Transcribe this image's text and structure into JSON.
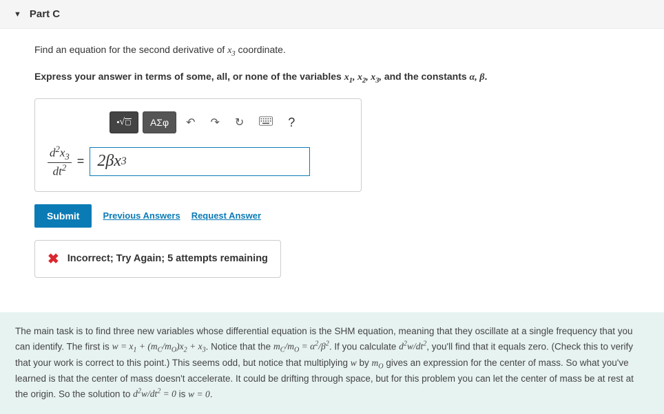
{
  "header": {
    "title": "Part C"
  },
  "question": {
    "line1_prefix": "Find an equation for the second derivative of ",
    "line1_var": "x₃",
    "line1_suffix": " coordinate.",
    "line2_prefix": "Express your answer in terms of some, all, or none of the variables ",
    "line2_vars": "x₁, x₂, x₃,",
    "line2_mid": " and the constants ",
    "line2_consts": "α, β",
    "line2_end": "."
  },
  "toolbar": {
    "math_btn": "√▭",
    "greek_btn": "ΑΣφ",
    "undo": "↶",
    "redo": "↷",
    "reset": "↻",
    "help": "?"
  },
  "equation": {
    "lhs_num": "d²x₃",
    "lhs_den": "dt²",
    "equals": "=",
    "answer": "2βx₃"
  },
  "actions": {
    "submit": "Submit",
    "previous": "Previous Answers",
    "request": "Request Answer"
  },
  "feedback": {
    "message": "Incorrect; Try Again; 5 attempts remaining"
  },
  "hint": {
    "text_html": "The main task is to find three new variables whose differential equation is the SHM equation, meaning that they oscillate at a single frequency that you can identify. The first is <span class='math'>w = x<sub>1</sub> + (m<sub>C</sub>/m<sub>O</sub>)x<sub>2</sub> + x<sub>3</sub></span>. Notice that the <span class='math'>m<sub>C</sub>/m<sub>O</sub> = α<sup>2</sup>/β<sup>2</sup></span>. If you calculate <span class='math'>d<sup>2</sup>w/dt<sup>2</sup></span>, you'll find that it equals zero. (Check this to verify that your work is correct to this point.) This seems odd, but notice that multiplying <span class='math'>w</span> by <span class='math'>m<sub>O</sub></span> gives an expression for the center of mass. So what you've learned is that the center of mass doesn't accelerate. It could be drifting through space, but for this problem you can let the center of mass be at rest at the origin. So the solution to <span class='math'>d<sup>2</sup>w/dt<sup>2</sup> = 0</span> is <span class='math'>w = 0</span>."
  }
}
